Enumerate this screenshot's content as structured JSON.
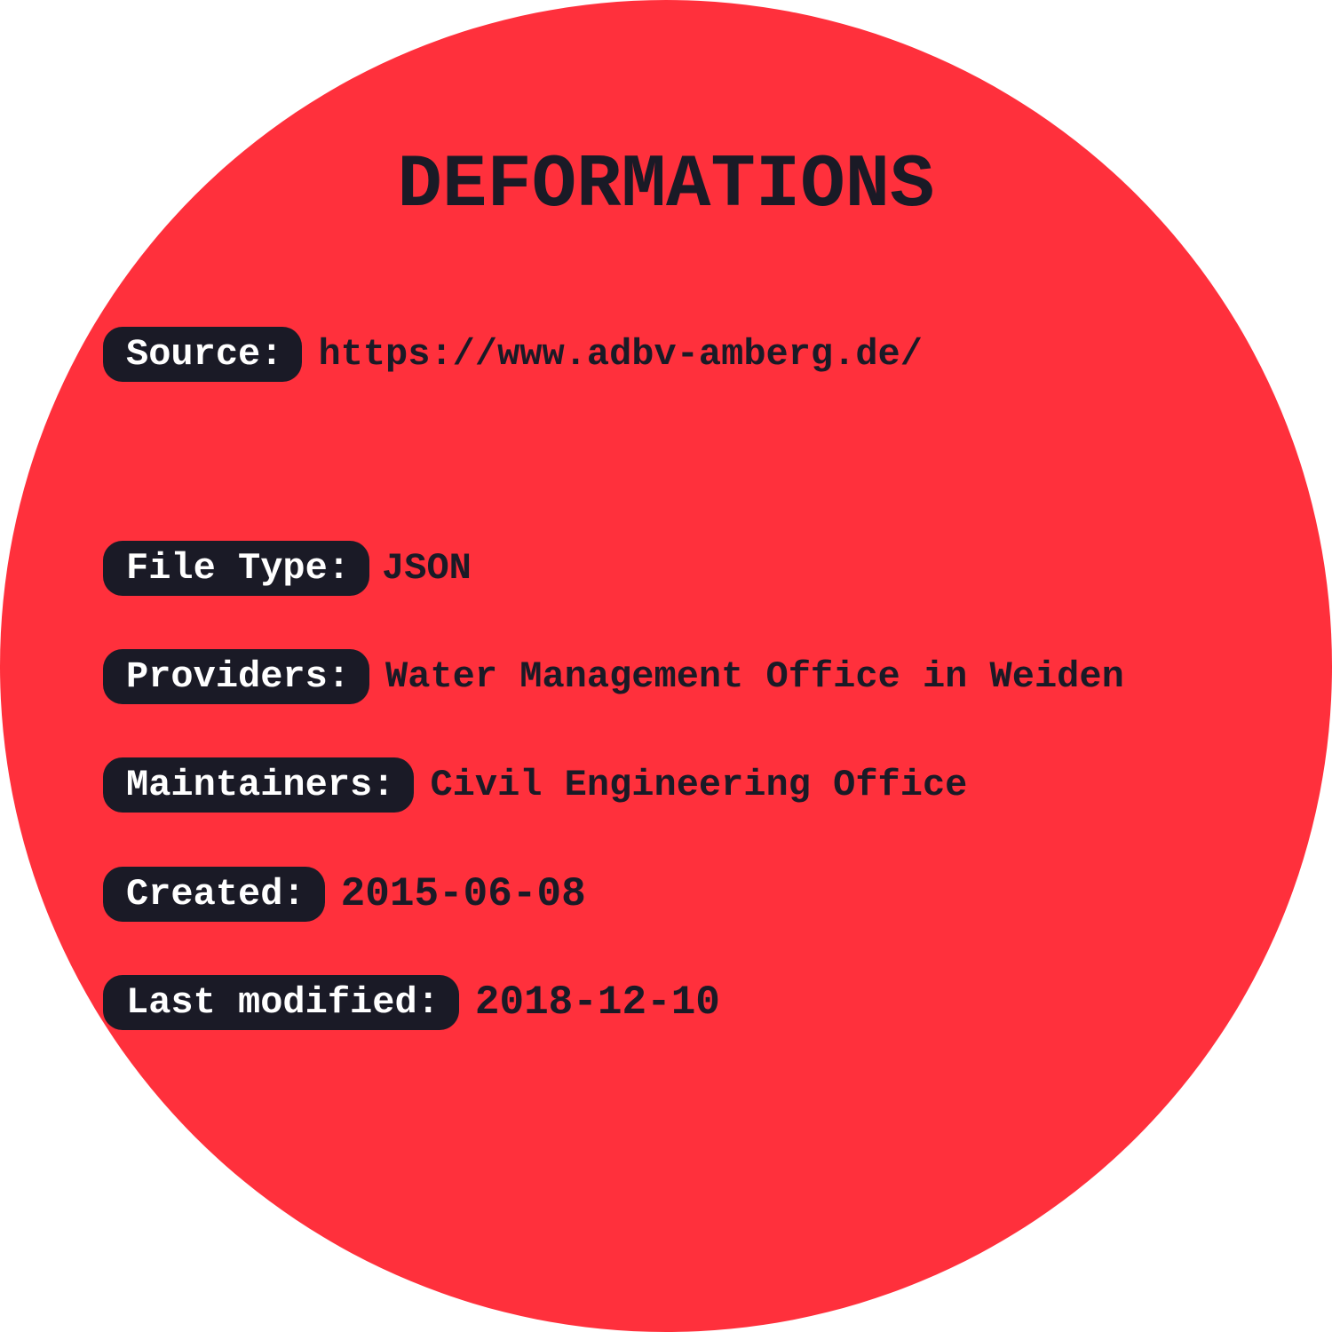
{
  "title": "DEFORMATIONS",
  "fields": {
    "source": {
      "label": "Source:",
      "value": "https://www.adbv-amberg.de/"
    },
    "file_type": {
      "label": "File Type:",
      "value": "JSON"
    },
    "providers": {
      "label": "Providers:",
      "value": "Water Management Office in Weiden"
    },
    "maintainers": {
      "label": "Maintainers:",
      "value": "Civil Engineering Office"
    },
    "created": {
      "label": "Created:",
      "value": "2015-06-08"
    },
    "last_modified": {
      "label": "Last modified:",
      "value": "2018-12-10"
    }
  },
  "colors": {
    "disc": "#ff303c",
    "label_background": "#1a1a26",
    "label_text": "#ffffff",
    "text": "#1a1a26"
  }
}
